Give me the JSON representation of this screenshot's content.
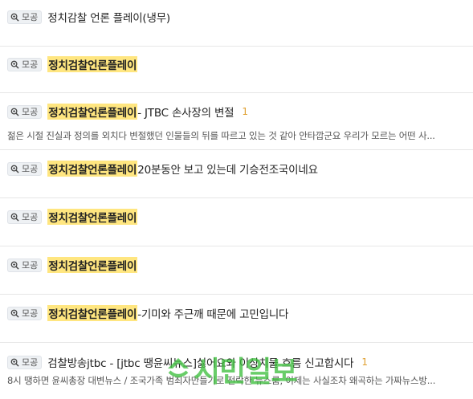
{
  "badge_label": "모공",
  "items": [
    {
      "prefix": "",
      "highlight": "",
      "title": "정치감찰 언론 플레이(냉무)",
      "count": "",
      "snippet": ""
    },
    {
      "prefix": "",
      "highlight": "정치검찰언론플레이",
      "title": "",
      "count": "",
      "snippet": ""
    },
    {
      "prefix": "",
      "highlight": "정치검찰언론플레이",
      "title": " - JTBC 손사장의 변절",
      "count": "1",
      "snippet": "젊은 시절 진실과 정의를 외치다 변절했던 인물들의 뒤를 따르고 있는 것 같아 안타깝군요 우리가 모르는 어떤 사..."
    },
    {
      "prefix": "",
      "highlight": "정치검찰언론플레이",
      "title": " 20분동안 보고 있는데 기승전조국이네요",
      "count": "",
      "snippet": ""
    },
    {
      "prefix": "",
      "highlight": "정치검찰언론플레이",
      "title": "",
      "count": "",
      "snippet": ""
    },
    {
      "prefix": "",
      "highlight": "정치검찰언론플레이",
      "title": "",
      "count": "",
      "snippet": ""
    },
    {
      "prefix": "",
      "highlight": "정치검찰언론플레이",
      "title": "-기미와 주근깨 때문에 고민입니다",
      "count": "",
      "snippet": ""
    },
    {
      "prefix": "검찰방송jtbc - [jtbc 땡윤씨뉴스] ",
      "highlight": "",
      "title": "싫어요와 이상치물 흐름 신고합시다",
      "count": "1",
      "snippet": "8시 땡하면 윤씨총장 대변뉴스 / 조국가족 범죄자만들기로 전락한 뉴스룸, 이제는 사실조차 왜곡하는 가짜뉴스방..."
    }
  ],
  "watermark": {
    "text": "시민일보",
    "color": "#3fbf3f"
  },
  "colors": {
    "highlight": "#ffe680",
    "count": "#e0a030"
  }
}
